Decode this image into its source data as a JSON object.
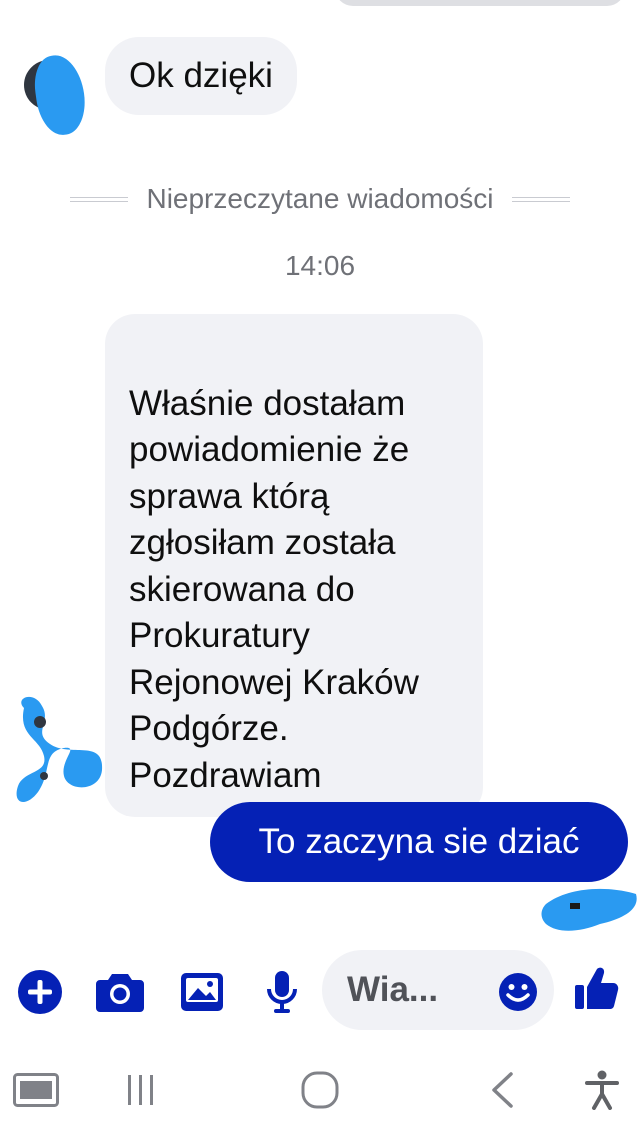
{
  "chat": {
    "incoming_short": "Ok dzięki",
    "unread_divider": "Nieprzeczytane wiadomości",
    "timestamp": "14:06",
    "incoming_long": "Właśnie dostałam\npowiadomienie że\nsprawa którą\nzgłosiłam została\nskierowana do\nProkuratury\nRejonowej Kraków\nPodgórze.\nPozdrawiam",
    "outgoing": "To zaczyna sie dziać"
  },
  "composer": {
    "placeholder": "Wia...",
    "icons": [
      "plus-icon",
      "camera-icon",
      "image-icon",
      "microphone-icon",
      "emoji-icon",
      "thumbs-up-icon"
    ]
  },
  "navbar": {
    "icons": [
      "screenshot-icon",
      "recent-apps-icon",
      "home-icon",
      "back-icon",
      "accessibility-icon"
    ]
  },
  "colors": {
    "accent": "#0521b5",
    "bubble_incoming": "#f1f2f6",
    "secondary_text": "#6f7177",
    "scribble": "#2a9af1"
  }
}
